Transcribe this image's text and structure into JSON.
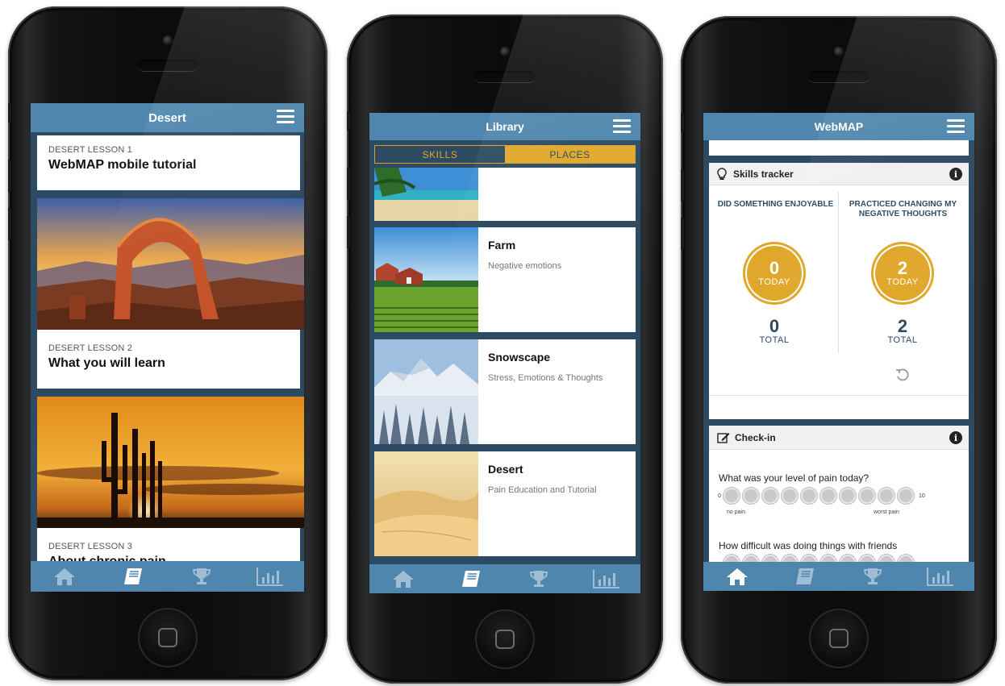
{
  "colors": {
    "header_blue": "#4f86ad",
    "dark_blue": "#2d4a63",
    "gold": "#e0a82b",
    "inactive_icon": "#9fbdd4"
  },
  "phone1": {
    "title": "Desert",
    "lessons": [
      {
        "label": "DESERT LESSON 1",
        "title": "WebMAP mobile tutorial"
      },
      {
        "label": "DESERT LESSON 2",
        "title": "What you will learn"
      },
      {
        "label": "DESERT LESSON 3",
        "title": "About chronic pain"
      }
    ],
    "active_tab": "library"
  },
  "phone2": {
    "title": "Library",
    "segments": {
      "skills": "SKILLS",
      "places": "PLACES"
    },
    "places": [
      {
        "name": "",
        "subtitle": ""
      },
      {
        "name": "Farm",
        "subtitle": "Negative emotions"
      },
      {
        "name": "Snowscape",
        "subtitle": "Stress, Emotions & Thoughts"
      },
      {
        "name": "Desert",
        "subtitle": "Pain Education and Tutorial"
      }
    ],
    "active_tab": "library"
  },
  "phone3": {
    "title": "WebMAP",
    "skills_tracker": {
      "header": "Skills tracker",
      "left": {
        "title": "DID SOMETHING ENJOYABLE",
        "today": "0",
        "today_label": "TODAY",
        "total": "0",
        "total_label": "TOTAL"
      },
      "right": {
        "title": "PRACTICED CHANGING MY NEGATIVE THOUGHTS",
        "today": "2",
        "today_label": "TODAY",
        "total": "2",
        "total_label": "TOTAL"
      }
    },
    "checkin": {
      "header": "Check-in",
      "q1": "What was your level of pain today?",
      "scale_min": "0",
      "scale_max": "10",
      "min_label": "no pain",
      "max_label": "worst pain",
      "q2": "How difficult was doing things with friends"
    },
    "active_tab": "home"
  },
  "tabs": [
    "home-icon",
    "book-icon",
    "trophy-icon",
    "bar-chart-icon"
  ]
}
